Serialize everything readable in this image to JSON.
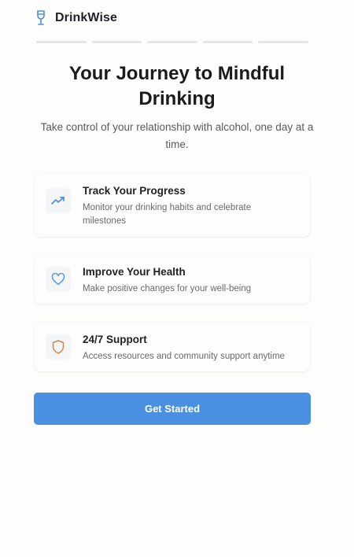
{
  "app": {
    "name": "DrinkWise",
    "icon": "wine-glass-icon",
    "brand_color": "#4a90e2"
  },
  "progress": {
    "total_steps": 5,
    "current_step": 0
  },
  "hero": {
    "title": "Your Journey to Mindful Drinking",
    "subtitle": "Take control of your relationship with alcohol, one day at a time."
  },
  "features": [
    {
      "icon": "trending-up-icon",
      "title": "Track Your Progress",
      "description": "Monitor your drinking habits and celebrate milestones",
      "icon_color": "#4a90e2"
    },
    {
      "icon": "heart-icon",
      "title": "Improve Your Health",
      "description": "Make positive changes for your well-being",
      "icon_color": "#5b9bd5"
    },
    {
      "icon": "shield-icon",
      "title": "24/7 Support",
      "description": "Access resources and community support anytime",
      "icon_color": "#c98a4b"
    }
  ],
  "cta": {
    "label": "Get Started"
  }
}
